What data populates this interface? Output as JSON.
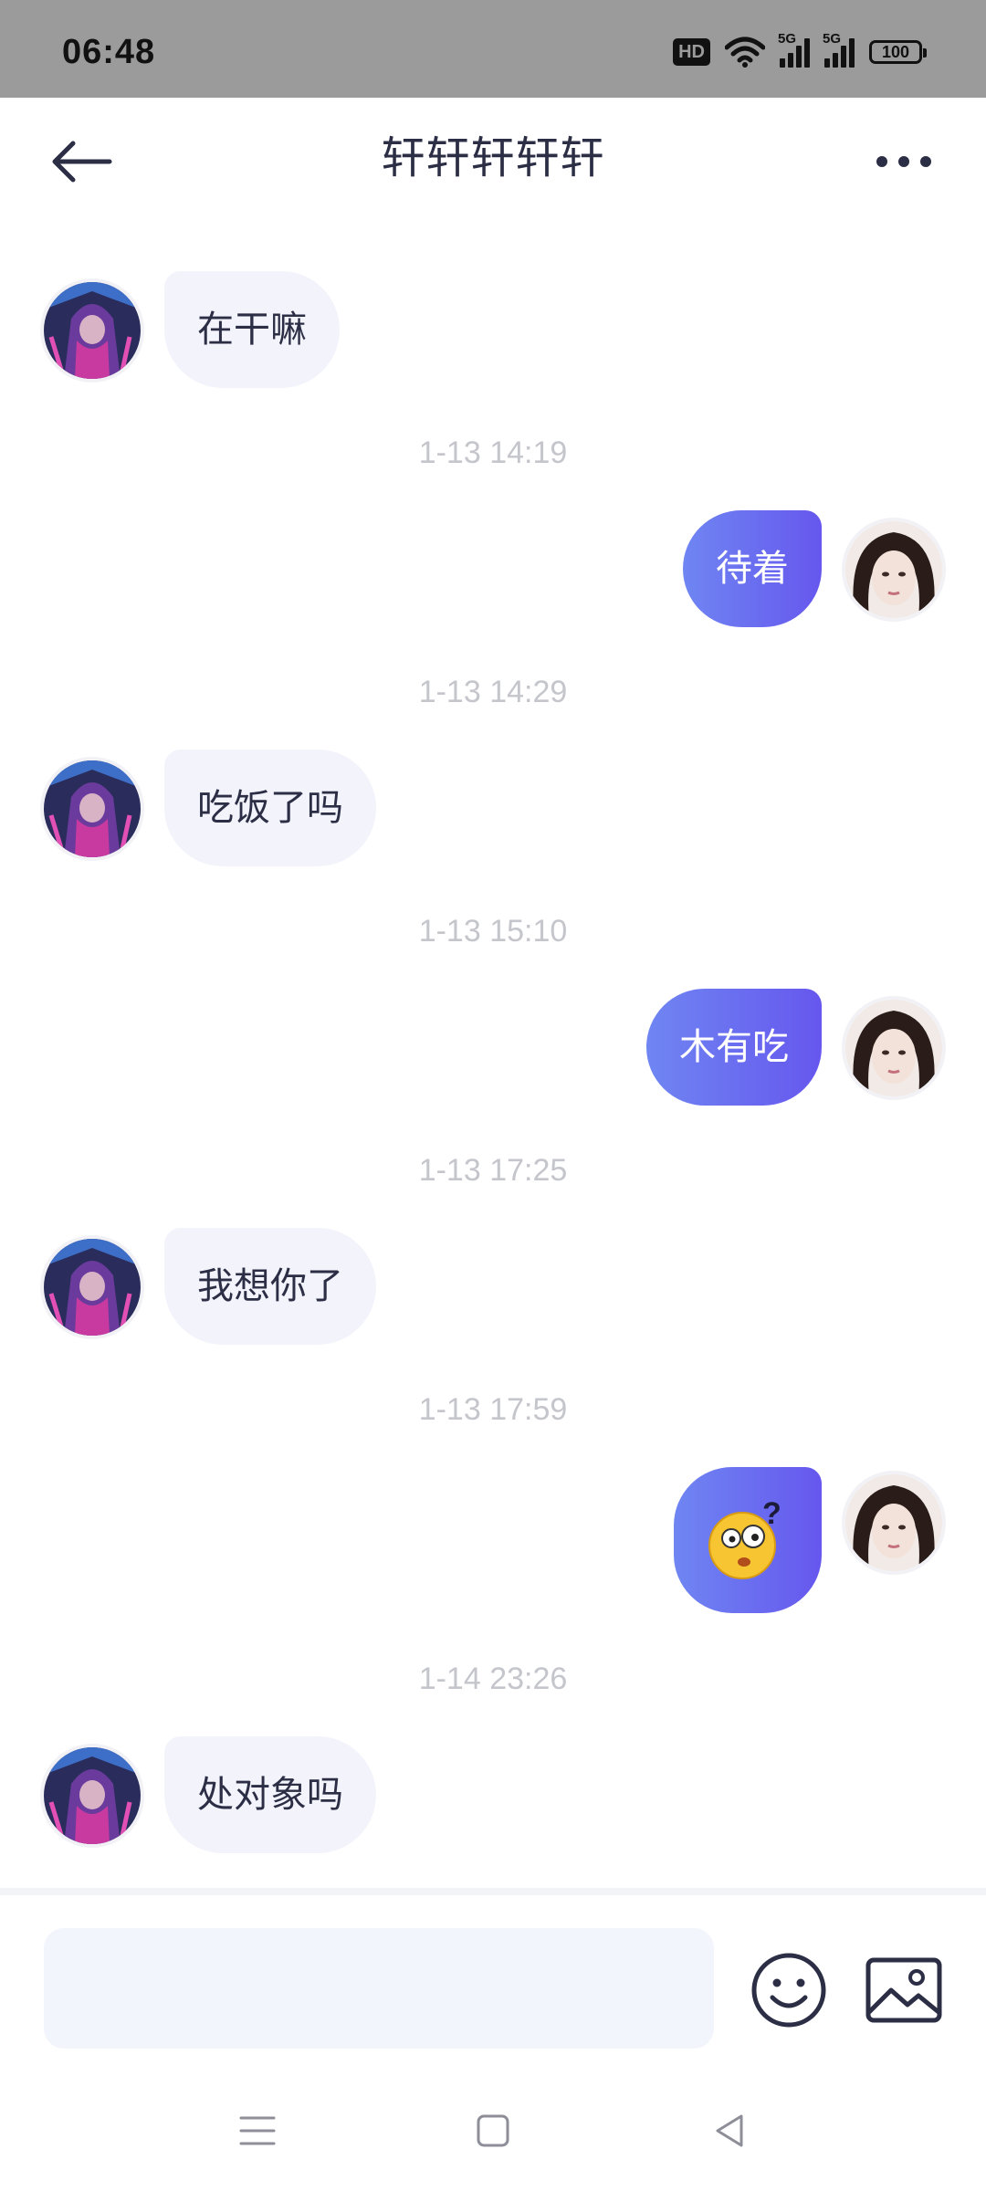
{
  "status_bar": {
    "time": "06:48",
    "hd": "HD",
    "sim1": "5G",
    "sim2": "5G",
    "battery": "100",
    "icons": [
      "hd-icon",
      "wifi-icon",
      "signal-icon",
      "signal-icon",
      "battery-icon"
    ]
  },
  "header": {
    "title": "轩轩轩轩轩",
    "back_icon": "arrow-left-icon",
    "more_icon": "more-dots-icon"
  },
  "messages": [
    {
      "from": "them",
      "text": "在干嘛"
    },
    {
      "timestamp": "1-13 14:19",
      "from": "me",
      "text": "待着"
    },
    {
      "timestamp": "1-13 14:29",
      "from": "them",
      "text": "吃饭了吗"
    },
    {
      "timestamp": "1-13 15:10",
      "from": "me",
      "text": "木有吃"
    },
    {
      "timestamp": "1-13 17:25",
      "from": "them",
      "text": "我想你了"
    },
    {
      "timestamp": "1-13 17:59",
      "from": "me",
      "emoji": "confused-face-emoji"
    },
    {
      "timestamp": "1-14 23:26",
      "from": "them",
      "text": "处对象吗"
    }
  ],
  "input": {
    "placeholder": "",
    "value": "",
    "emoji_icon": "smiley-icon",
    "image_icon": "image-icon"
  },
  "nav": {
    "icons": [
      "menu-icon",
      "home-square-icon",
      "back-triangle-icon"
    ]
  },
  "colors": {
    "status_bar_bg": "#9b9b9b",
    "incoming_bubble": "#f3f3fb",
    "outgoing_gradient_start": "#6f86f2",
    "outgoing_gradient_end": "#6657ee",
    "timestamp": "#c5c6cc",
    "text": "#2b2e45"
  }
}
